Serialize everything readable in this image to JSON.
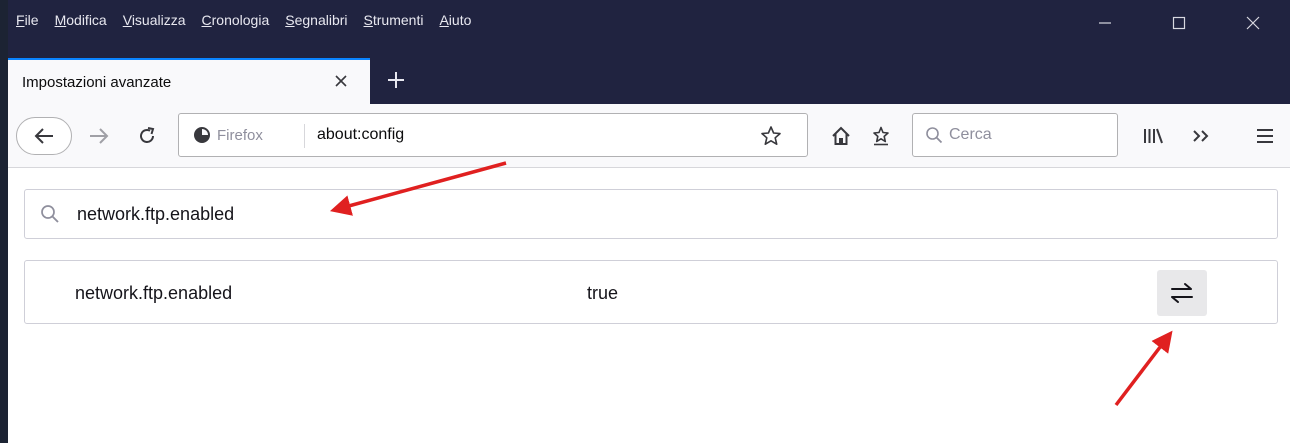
{
  "menubar": {
    "items": [
      "File",
      "Modifica",
      "Visualizza",
      "Cronologia",
      "Segnalibri",
      "Strumenti",
      "Aiuto"
    ]
  },
  "window_controls": {
    "icons": [
      "minimize-icon",
      "maximize-icon",
      "close-icon"
    ]
  },
  "tab": {
    "title": "Impostazioni avanzate"
  },
  "navbar": {
    "identity_label": "Firefox",
    "url": "about:config",
    "search_placeholder": "Cerca"
  },
  "page": {
    "filter_value": "network.ftp.enabled",
    "pref": {
      "name": "network.ftp.enabled",
      "value": "true"
    }
  },
  "colors": {
    "titlebar": "#202340",
    "tab_accent": "#0a84ff",
    "annotation_arrow": "#e02020",
    "toolbar_bg": "#f9f9fb"
  }
}
